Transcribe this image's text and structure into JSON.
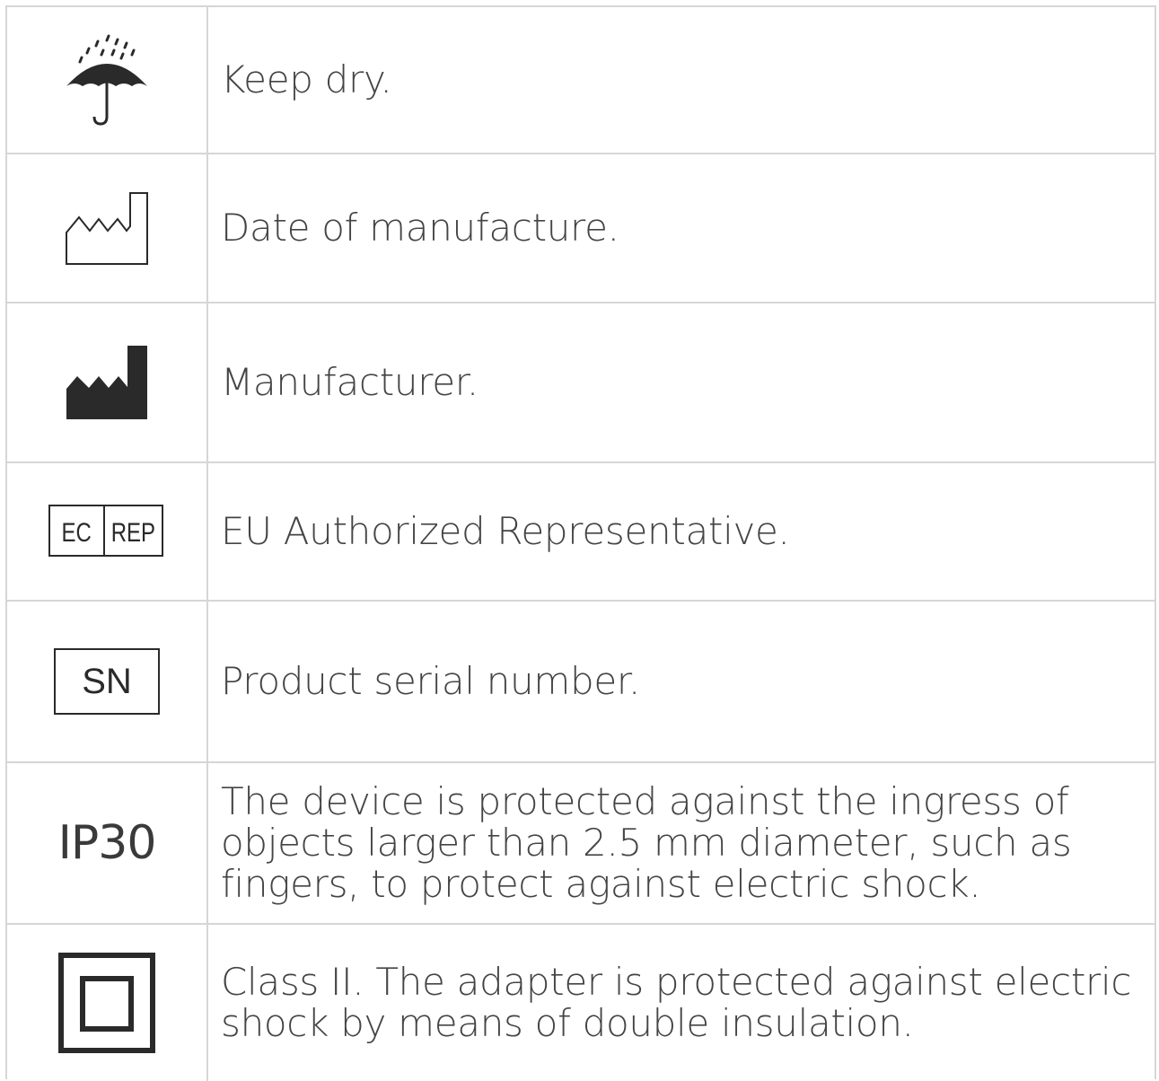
{
  "rows": [
    {
      "icon": "keep-dry-umbrella-icon",
      "description": "Keep dry."
    },
    {
      "icon": "date-of-manufacture-icon",
      "description": "Date of manufacture."
    },
    {
      "icon": "manufacturer-icon",
      "description": "Manufacturer."
    },
    {
      "icon": "ec-rep-icon",
      "icon_text_left": "EC",
      "icon_text_right": "REP",
      "description": "EU Authorized Representative."
    },
    {
      "icon": "serial-number-icon",
      "icon_text": "SN",
      "description": "Product serial number."
    },
    {
      "icon": "ip30-icon",
      "icon_text": "IP30",
      "description": "The device is protected against the ingress of objects larger than 2.5 mm diameter, such as fingers, to protect against electric shock."
    },
    {
      "icon": "class-ii-double-insulation-icon",
      "description": "Class II. The adapter is protected against electric shock by means of double insulation."
    }
  ]
}
